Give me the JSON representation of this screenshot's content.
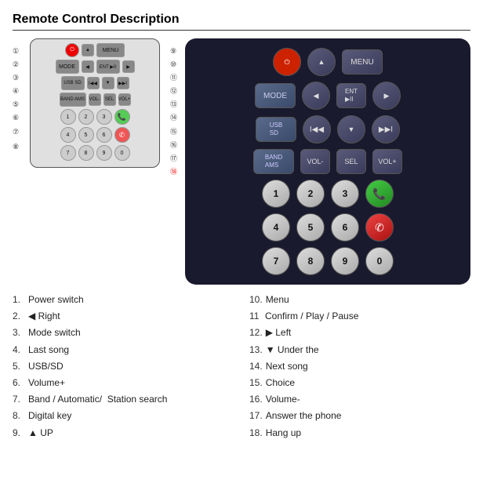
{
  "title": "Remote Control Description",
  "diagram": {
    "rows": [
      {
        "items": [
          {
            "label": "⏻",
            "type": "power"
          },
          {
            "label": "▲",
            "type": "arrow"
          },
          {
            "label": "MENU",
            "type": "dark"
          }
        ]
      },
      {
        "items": [
          {
            "label": "MODE",
            "type": "dark"
          },
          {
            "label": "◀",
            "type": "arrow"
          },
          {
            "label": "ENT ▶II",
            "type": "dark"
          },
          {
            "label": "▶",
            "type": "arrow"
          }
        ]
      },
      {
        "items": [
          {
            "label": "USB SD",
            "type": "dark"
          },
          {
            "label": "I◀◀",
            "type": "arrow"
          },
          {
            "label": "▼",
            "type": "arrow"
          },
          {
            "label": "▶▶I",
            "type": "arrow"
          }
        ]
      },
      {
        "items": [
          {
            "label": "BAND AMS",
            "type": "dark"
          },
          {
            "label": "VOL-",
            "type": "dark"
          },
          {
            "label": "SEL",
            "type": "dark"
          },
          {
            "label": "VOL+",
            "type": "dark"
          }
        ]
      },
      {
        "items": [
          {
            "label": "1",
            "type": "num"
          },
          {
            "label": "2",
            "type": "num"
          },
          {
            "label": "3",
            "type": "num"
          },
          {
            "label": "📞",
            "type": "green"
          }
        ]
      },
      {
        "items": [
          {
            "label": "4",
            "type": "num"
          },
          {
            "label": "5",
            "type": "num"
          },
          {
            "label": "6",
            "type": "num"
          },
          {
            "label": "📵",
            "type": "red"
          }
        ]
      },
      {
        "items": [
          {
            "label": "7",
            "type": "num"
          },
          {
            "label": "8",
            "type": "num"
          },
          {
            "label": "9",
            "type": "num"
          },
          {
            "label": "0",
            "type": "num"
          }
        ]
      }
    ]
  },
  "real_remote": {
    "rows": [
      {
        "items": [
          {
            "label": "⏻",
            "type": "power"
          },
          {
            "label": "▲",
            "type": "arrow"
          },
          {
            "label": "MENU",
            "type": "wide"
          }
        ]
      },
      {
        "items": [
          {
            "label": "MODE",
            "type": "mode"
          },
          {
            "label": "◀",
            "type": "arrow"
          },
          {
            "label": "ENT\n▶II",
            "type": "normal"
          },
          {
            "label": "▶",
            "type": "arrow"
          }
        ]
      },
      {
        "items": [
          {
            "label": "USB\nSD",
            "type": "usbsd"
          },
          {
            "label": "I◀◀",
            "type": "arrow"
          },
          {
            "label": "▼",
            "type": "arrow"
          },
          {
            "label": "▶▶I",
            "type": "arrow"
          }
        ]
      },
      {
        "items": [
          {
            "label": "BAND\nAMS",
            "type": "band"
          },
          {
            "label": "VOL-",
            "type": "normal"
          },
          {
            "label": "SEL",
            "type": "normal"
          },
          {
            "label": "VOL+",
            "type": "normal"
          }
        ]
      },
      {
        "items": [
          {
            "label": "1",
            "type": "num"
          },
          {
            "label": "2",
            "type": "num"
          },
          {
            "label": "3",
            "type": "num"
          },
          {
            "label": "📞",
            "type": "green"
          }
        ]
      },
      {
        "items": [
          {
            "label": "4",
            "type": "num"
          },
          {
            "label": "5",
            "type": "num"
          },
          {
            "label": "6",
            "type": "num"
          },
          {
            "label": "📵",
            "type": "red"
          }
        ]
      },
      {
        "items": [
          {
            "label": "7",
            "type": "num"
          },
          {
            "label": "8",
            "type": "num"
          },
          {
            "label": "9",
            "type": "num"
          },
          {
            "label": "0",
            "type": "num"
          }
        ]
      }
    ]
  },
  "descriptions": [
    {
      "num": "1.",
      "text": "Power switch"
    },
    {
      "num": "10.",
      "text": "Menu"
    },
    {
      "num": "2.",
      "text": "◀ Right"
    },
    {
      "num": "11",
      "text": "Confirm / Play / Pause"
    },
    {
      "num": "3.",
      "text": "Mode switch"
    },
    {
      "num": "12.",
      "text": "▶ Left"
    },
    {
      "num": "4.",
      "text": "Last song"
    },
    {
      "num": "13.",
      "text": "▼ Under the"
    },
    {
      "num": "5.",
      "text": "USB/SD"
    },
    {
      "num": "14.",
      "text": "Next song"
    },
    {
      "num": "6.",
      "text": "Volume+"
    },
    {
      "num": "15.",
      "text": "Choice"
    },
    {
      "num": "7.",
      "text": "Band / Automatic/  Station search"
    },
    {
      "num": "16.",
      "text": "Volume-"
    },
    {
      "num": "8.",
      "text": "Digital key"
    },
    {
      "num": "17.",
      "text": "Answer the phone"
    },
    {
      "num": "9.",
      "text": "▲ UP"
    },
    {
      "num": "18.",
      "text": "Hang up"
    }
  ]
}
